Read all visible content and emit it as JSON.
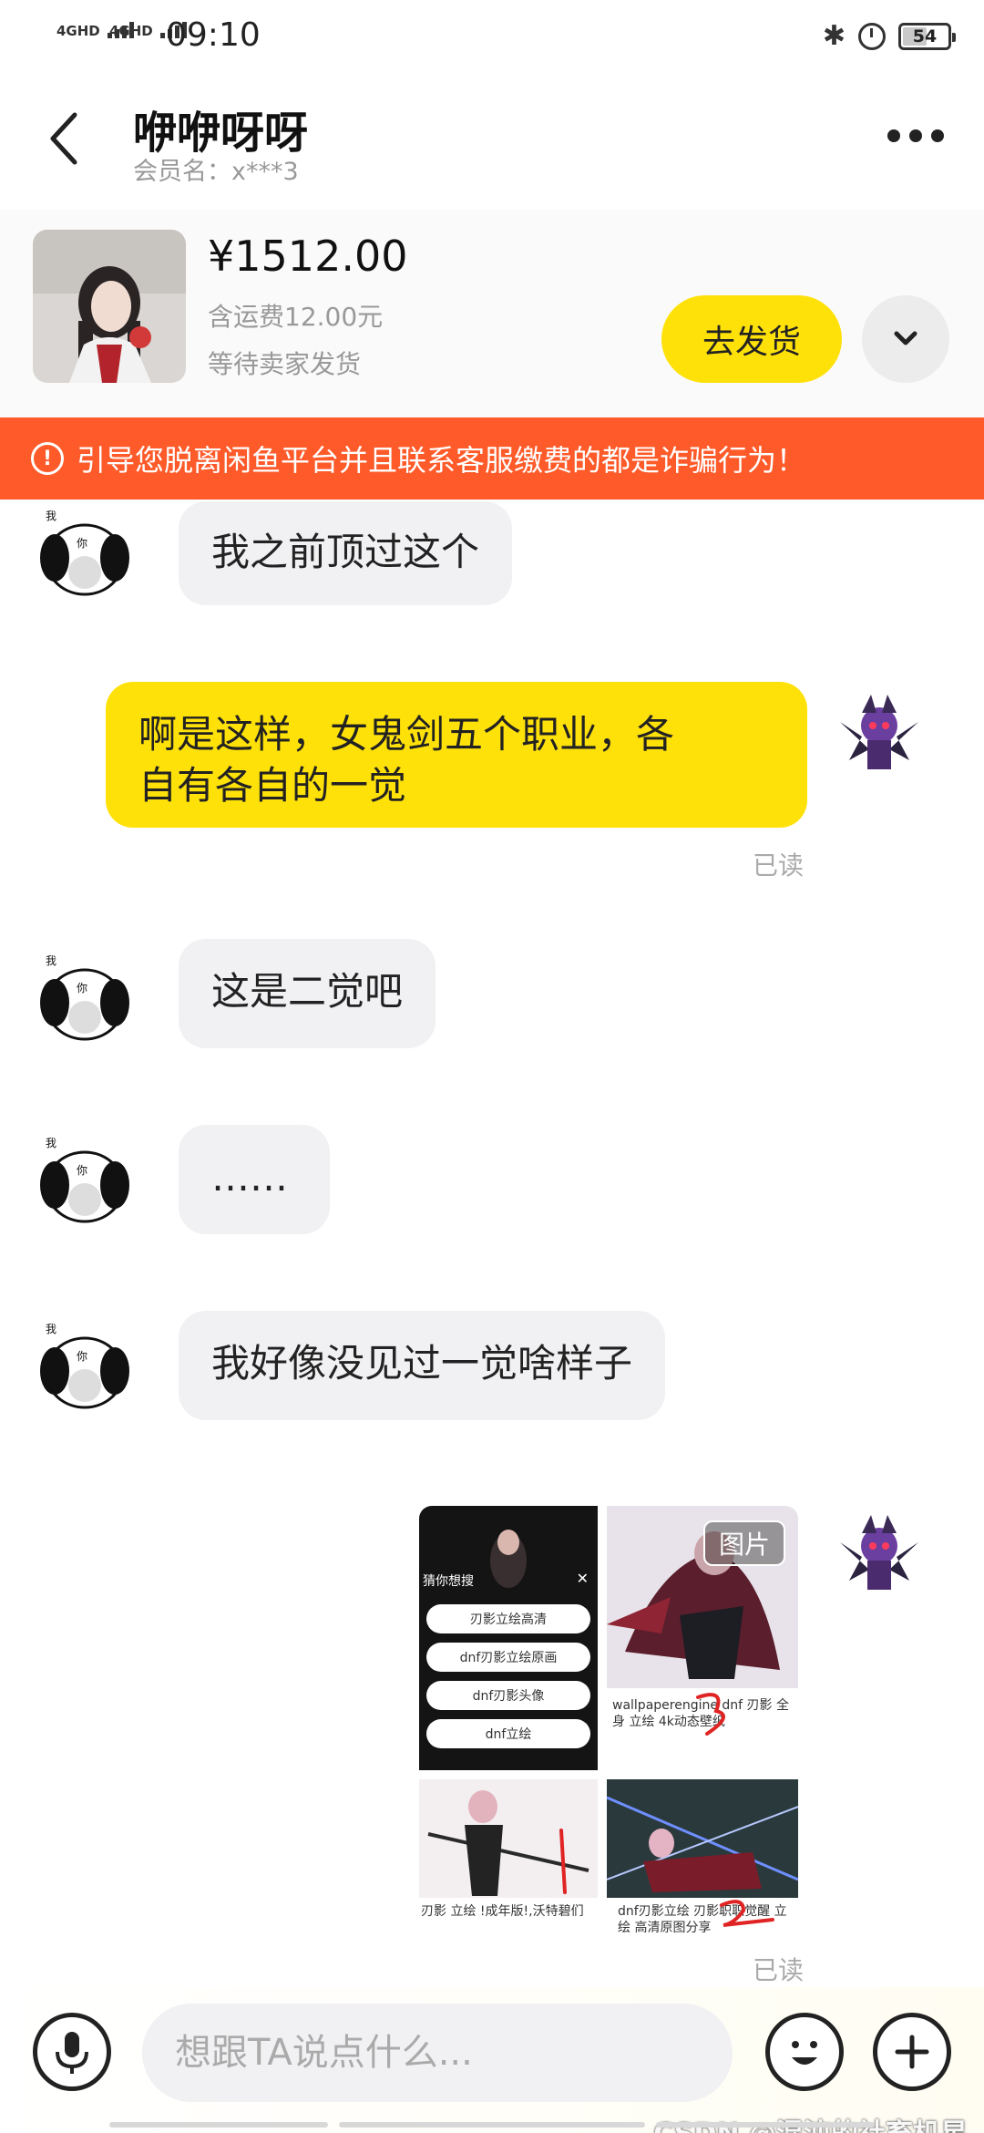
{
  "status_bar": {
    "signal_1": "4GHD",
    "signal_2": "4GHD",
    "time": "09:10",
    "battery": "54"
  },
  "header": {
    "title": "咿咿呀呀",
    "member": "会员名：x***3"
  },
  "product": {
    "price": "¥1512.00",
    "shipping": "含运费12.00元",
    "status": "等待卖家发货",
    "ship_button": "去发货"
  },
  "warning": {
    "text": "引导您脱离闲鱼平台并且联系客服缴费的都是诈骗行为！"
  },
  "messages": [
    {
      "side": "in",
      "text": "我之前顶过这个"
    },
    {
      "side": "out",
      "text_line1": "啊是这样，女鬼剑五个职业，各",
      "text_line2": "自有各自的一觉",
      "read": "已读"
    },
    {
      "side": "in",
      "text": "这是二觉吧"
    },
    {
      "side": "in",
      "text": "……"
    },
    {
      "side": "in",
      "text": "我好像没见过一觉啥样子"
    }
  ],
  "image_message": {
    "tag": "图片",
    "read": "已读",
    "search_title": "猜你想搜",
    "suggestions": [
      "刃影立绘高清",
      "dnf刃影立绘原画",
      "dnf刃影头像",
      "dnf立绘"
    ],
    "caption_top_right": "wallpaperengine dnf 刃影 全身 立绘 4k动态壁纸",
    "caption_bottom_left": "刃影 立绘 !成年版!,沃特碧们",
    "caption_bottom_right": "dnf刃影立绘 刃影职职觉醒 立绘 高清原图分享",
    "marks": [
      "1",
      "2",
      "3"
    ]
  },
  "input": {
    "placeholder": "想跟TA说点什么..."
  },
  "watermark": "CSDN @混沌的社畜机星",
  "colors": {
    "accent_yellow": "#ffe10a",
    "warning_orange": "#ff5a29",
    "bubble_gray": "#f1f1f3"
  },
  "icons": [
    "back-arrow-icon",
    "more-dots-icon",
    "chevron-down-icon",
    "warning-circle-icon",
    "microphone-icon",
    "emoji-icon",
    "plus-icon"
  ]
}
